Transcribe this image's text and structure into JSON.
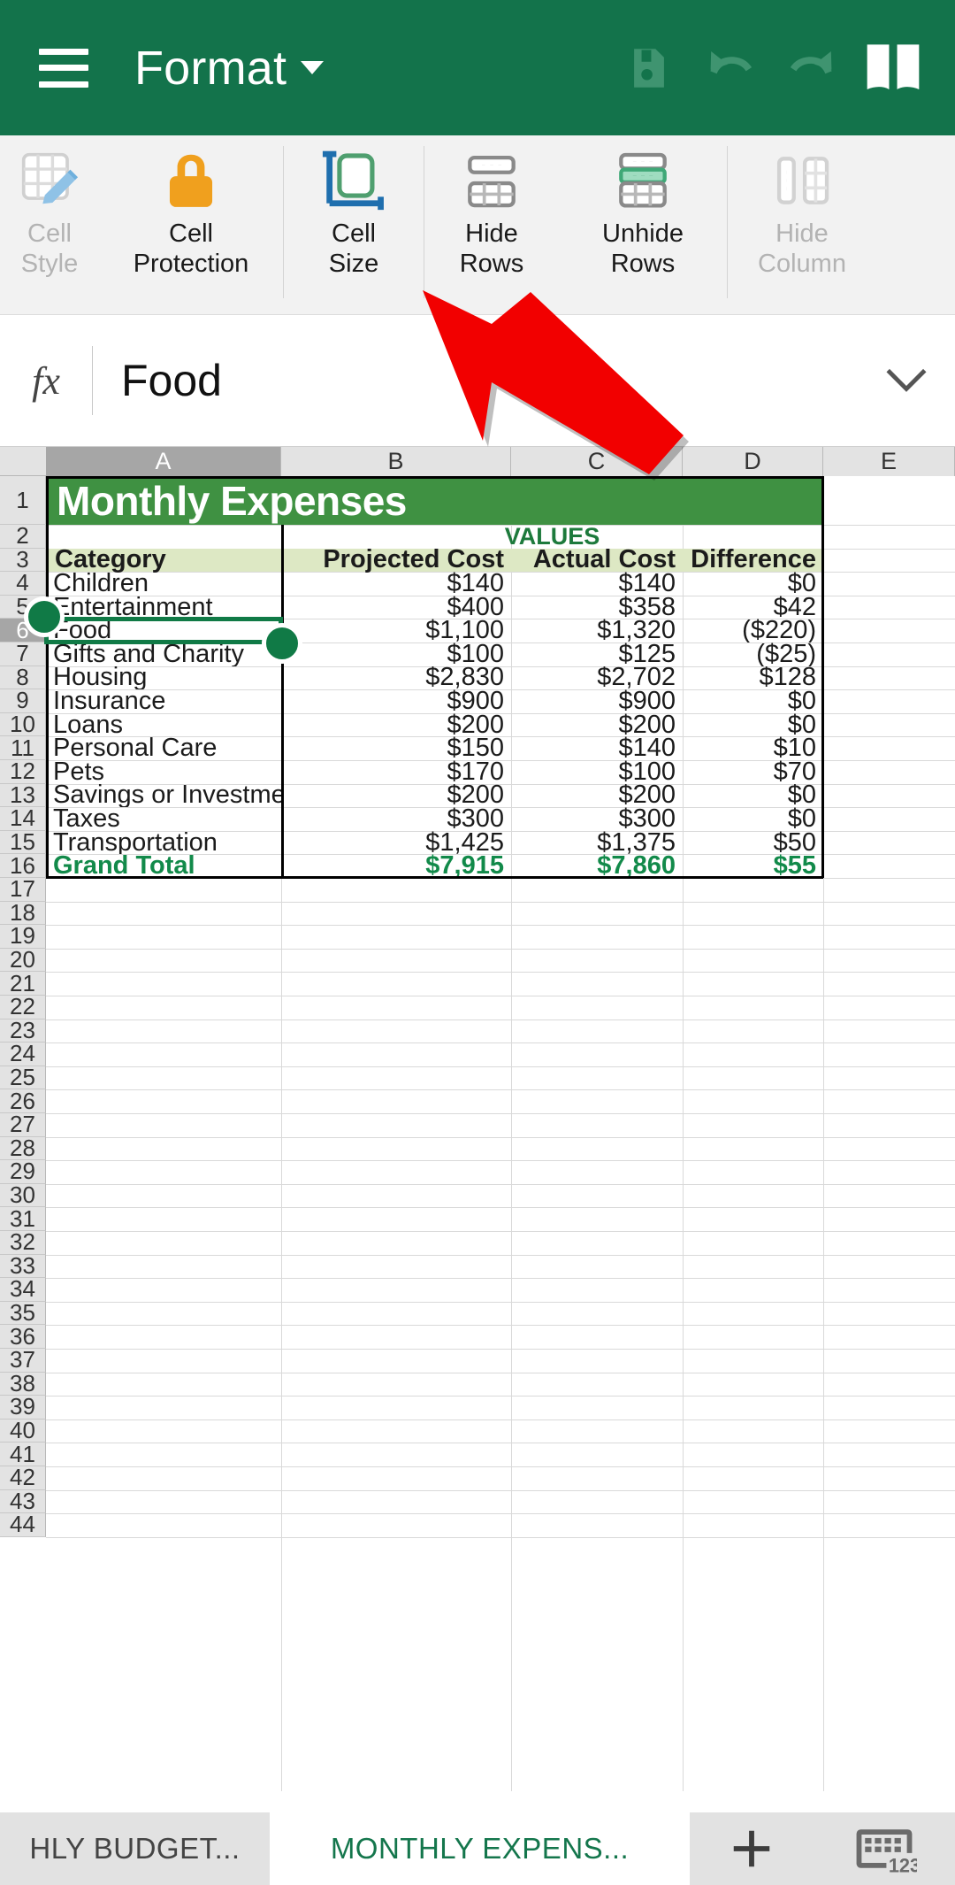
{
  "appbar": {
    "menu_icon": "hamburger-menu-icon",
    "title": "Format",
    "dropdown_caret": "chevron-down-icon",
    "actions": [
      {
        "name": "save-icon",
        "label": "Save",
        "state": "disabled"
      },
      {
        "name": "undo-icon",
        "label": "Undo",
        "state": "disabled"
      },
      {
        "name": "redo-icon",
        "label": "Redo",
        "state": "disabled"
      },
      {
        "name": "book-icon",
        "label": "Reading view",
        "state": "enabled"
      }
    ],
    "bg_color": "#13734b"
  },
  "ribbon": {
    "items": [
      {
        "label_line1": "Cell",
        "label_line2": "Style",
        "icon": "cell-style-icon",
        "disabled": true
      },
      {
        "label_line1": "Cell",
        "label_line2": "Protection",
        "icon": "lock-icon",
        "disabled": false
      },
      {
        "label_line1": "Cell",
        "label_line2": "Size",
        "icon": "cell-size-icon",
        "disabled": false
      },
      {
        "label_line1": "Hide",
        "label_line2": "Rows",
        "icon": "hide-rows-icon",
        "disabled": false
      },
      {
        "label_line1": "Unhide",
        "label_line2": "Rows",
        "icon": "unhide-rows-icon",
        "disabled": false
      },
      {
        "label_line1": "Hide",
        "label_line2": "Column",
        "icon": "hide-columns-icon",
        "disabled": true
      }
    ]
  },
  "formula_bar": {
    "fx_label": "fx",
    "value": "Food",
    "expand_icon": "chevron-down-icon"
  },
  "sheet": {
    "selected_cell": "A6",
    "selected_column": "A",
    "selected_row": 6,
    "column_headers": [
      "A",
      "B",
      "C",
      "D",
      "E"
    ],
    "row_numbers": [
      1,
      2,
      3,
      4,
      5,
      6,
      7,
      8,
      9,
      10,
      11,
      12,
      13,
      14,
      15,
      16,
      17,
      18,
      19,
      20,
      21,
      22,
      23,
      24,
      25,
      26,
      27,
      28,
      29,
      30,
      31,
      32,
      33,
      34,
      35,
      36,
      37,
      38,
      39,
      40,
      41,
      42,
      43,
      44
    ],
    "title_cell": "Monthly Expenses",
    "values_label": "VALUES",
    "headers": {
      "category": "Category",
      "projected": "Projected Cost",
      "actual": "Actual Cost",
      "difference": "Difference"
    },
    "rows": [
      {
        "row": 4,
        "category": "Children",
        "projected": "$140",
        "actual": "$140",
        "difference": "$0"
      },
      {
        "row": 5,
        "category": "Entertainment",
        "projected": "$400",
        "actual": "$358",
        "difference": "$42"
      },
      {
        "row": 6,
        "category": "Food",
        "projected": "$1,100",
        "actual": "$1,320",
        "difference": "($220)"
      },
      {
        "row": 7,
        "category": "Gifts and Charity",
        "projected": "$100",
        "actual": "$125",
        "difference": "($25)"
      },
      {
        "row": 8,
        "category": "Housing",
        "projected": "$2,830",
        "actual": "$2,702",
        "difference": "$128"
      },
      {
        "row": 9,
        "category": "Insurance",
        "projected": "$900",
        "actual": "$900",
        "difference": "$0"
      },
      {
        "row": 10,
        "category": "Loans",
        "projected": "$200",
        "actual": "$200",
        "difference": "$0"
      },
      {
        "row": 11,
        "category": "Personal Care",
        "projected": "$150",
        "actual": "$140",
        "difference": "$10"
      },
      {
        "row": 12,
        "category": "Pets",
        "projected": "$170",
        "actual": "$100",
        "difference": "$70"
      },
      {
        "row": 13,
        "category": "Savings or Investments",
        "projected": "$200",
        "actual": "$200",
        "difference": "$0"
      },
      {
        "row": 14,
        "category": "Taxes",
        "projected": "$300",
        "actual": "$300",
        "difference": "$0"
      },
      {
        "row": 15,
        "category": "Transportation",
        "projected": "$1,425",
        "actual": "$1,375",
        "difference": "$50"
      }
    ],
    "total_row": {
      "row": 16,
      "category": "Grand Total",
      "projected": "$7,915",
      "actual": "$7,860",
      "difference": "$55"
    },
    "colors": {
      "title_fill": "#3f9142",
      "header_fill": "#dde8c4",
      "total_text": "#128a4a",
      "values_text": "#1d7a3c",
      "selection": "#107a46"
    }
  },
  "annotation": {
    "arrow_icon": "red-pointer-arrow-icon",
    "arrow_color": "#f20000",
    "points_to": "Cell Size"
  },
  "tabbar": {
    "tabs": [
      {
        "label": "HLY BUDGET...",
        "active": false
      },
      {
        "label": "MONTHLY EXPENS...",
        "active": true
      }
    ],
    "add_label": "+",
    "keypad_label": "123",
    "keypad_icon": "numeric-keypad-icon"
  }
}
